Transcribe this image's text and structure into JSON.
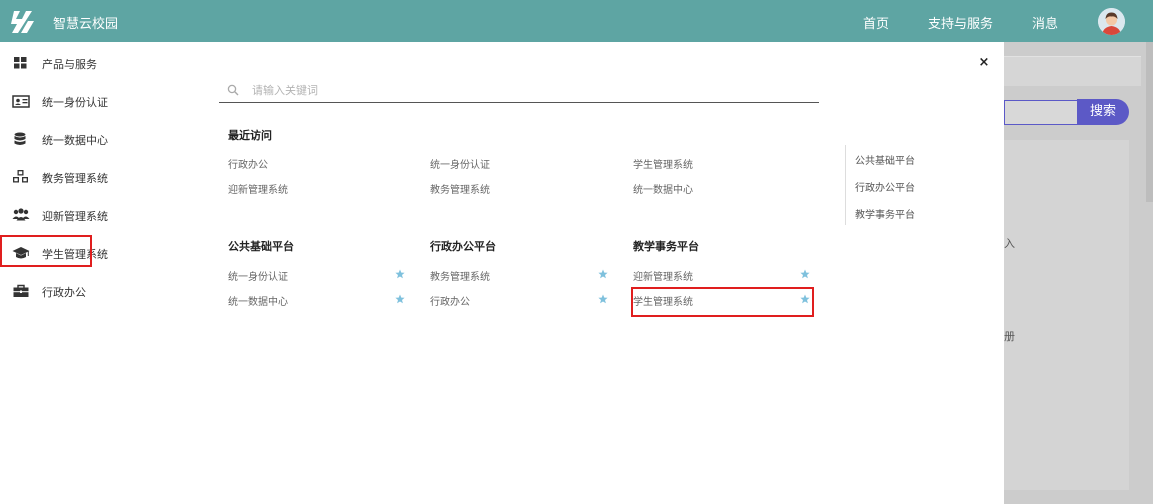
{
  "header": {
    "app_title": "智慧云校园",
    "nav": [
      "首页",
      "支持与服务",
      "消息"
    ],
    "bg_color": "#5ea5a3"
  },
  "sidebar": {
    "items": [
      {
        "label": "产品与服务",
        "icon": "grid-icon"
      },
      {
        "label": "统一身份认证",
        "icon": "id-card-icon"
      },
      {
        "label": "统一数据中心",
        "icon": "database-icon"
      },
      {
        "label": "教务管理系统",
        "icon": "cubes-icon"
      },
      {
        "label": "迎新管理系统",
        "icon": "users-icon"
      },
      {
        "label": "学生管理系统",
        "icon": "graduation-cap-icon"
      },
      {
        "label": "行政办公",
        "icon": "briefcase-icon"
      }
    ]
  },
  "search": {
    "placeholder": "请输入关键词",
    "value": ""
  },
  "recent": {
    "title": "最近访问",
    "links": [
      [
        "行政办公",
        "统一身份认证",
        "学生管理系统"
      ],
      [
        "迎新管理系统",
        "教务管理系统",
        "统一数据中心"
      ]
    ]
  },
  "categories": [
    {
      "title": "公共基础平台",
      "links": [
        "统一身份认证",
        "统一数据中心"
      ]
    },
    {
      "title": "行政办公平台",
      "links": [
        "教务管理系统",
        "行政办公"
      ]
    },
    {
      "title": "教学事务平台",
      "links": [
        "迎新管理系统",
        "学生管理系统"
      ]
    }
  ],
  "right_nav": [
    "公共基础平台",
    "行政办公平台",
    "教学事务平台"
  ],
  "background": {
    "search_button": "搜索",
    "glyph_1": "入",
    "glyph_2": "册"
  },
  "colors": {
    "accent": "#5ea5a3",
    "star": "#7fc1dd",
    "highlight": "#e01e1e",
    "search_button": "#5c59c6"
  }
}
